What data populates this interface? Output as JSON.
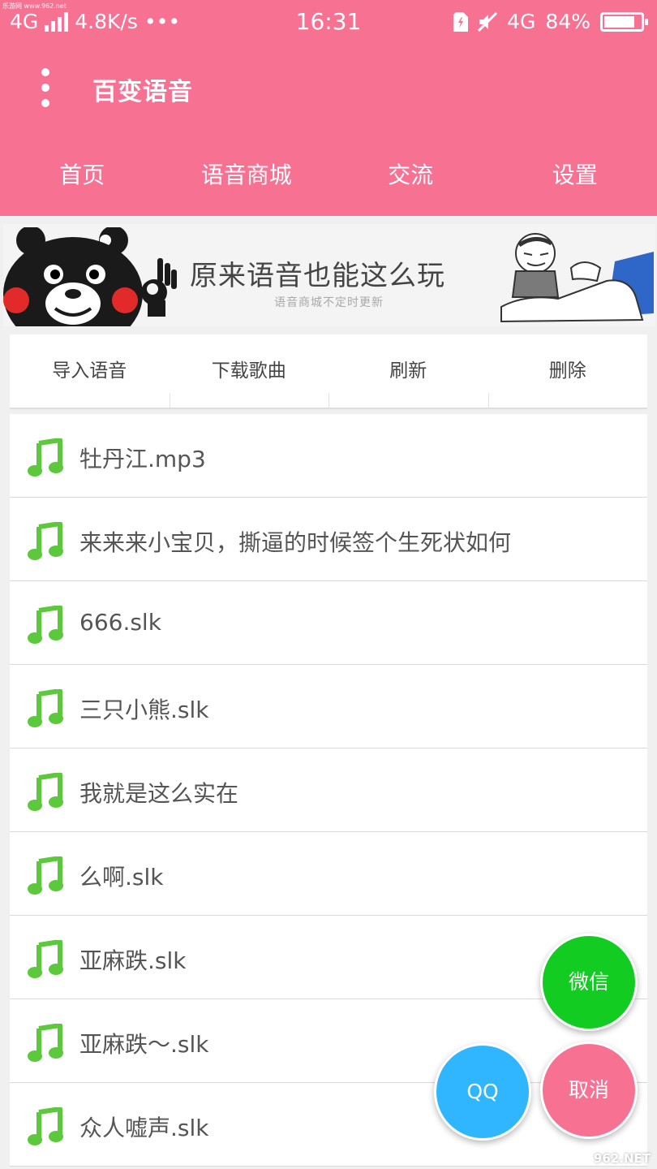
{
  "status_bar": {
    "watermark_top": "乐游网 www.962.net",
    "network": "4G",
    "speed": "4.8K/s",
    "more": "•••",
    "time": "16:31",
    "network_right": "4G",
    "battery": "84%",
    "battery_level": 0.84
  },
  "app_bar": {
    "title": "百变语音"
  },
  "tabs": [
    {
      "label": "首页"
    },
    {
      "label": "语音商城"
    },
    {
      "label": "交流"
    },
    {
      "label": "设置"
    }
  ],
  "banner": {
    "title": "原来语音也能这么玩",
    "subtitle": "语音商城不定时更新"
  },
  "actions": [
    {
      "label": "导入语音"
    },
    {
      "label": "下载歌曲"
    },
    {
      "label": "刷新"
    },
    {
      "label": "删除"
    }
  ],
  "files": [
    {
      "name": "牡丹江.mp3",
      "icon": "music-note-icon"
    },
    {
      "name": "来来来小宝贝，撕逼的时候签个生死状如何",
      "icon": "music-note-icon"
    },
    {
      "name": "666.slk",
      "icon": "music-note-icon"
    },
    {
      "name": "三只小熊.slk",
      "icon": "music-note-icon"
    },
    {
      "name": "我就是这么实在",
      "icon": "music-note-icon"
    },
    {
      "name": "么啊.slk",
      "icon": "music-note-icon"
    },
    {
      "name": "亚麻跌.slk",
      "icon": "music-note-icon"
    },
    {
      "name": "亚麻跌～.slk",
      "icon": "music-note-icon"
    },
    {
      "name": "众人嘘声.slk",
      "icon": "music-note-icon"
    }
  ],
  "share": {
    "wechat": "微信",
    "qq": "QQ",
    "cancel": "取消"
  },
  "watermark": "962.NET",
  "colors": {
    "primary": "#f77193",
    "note_green": "#5cc83c",
    "wechat": "#12cc22",
    "qq": "#2fb6ff"
  }
}
